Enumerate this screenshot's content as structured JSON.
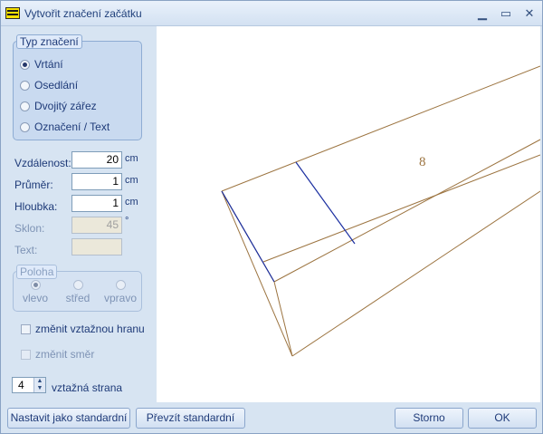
{
  "window": {
    "title": "Vytvořit značení začátku"
  },
  "type_group": {
    "legend": "Typ značení",
    "options": [
      "Vrtání",
      "Osedlání",
      "Dvojitý zářez",
      "Označení / Text"
    ],
    "selected": "Vrtání"
  },
  "fields": {
    "distance": {
      "label": "Vzdálenost:",
      "value": "20",
      "unit": "cm"
    },
    "diameter": {
      "label": "Průměr:",
      "value": "1",
      "unit": "cm"
    },
    "depth": {
      "label": "Hloubka:",
      "value": "1",
      "unit": "cm"
    },
    "slope": {
      "label": "Sklon:",
      "value": "45",
      "unit": "°"
    },
    "text": {
      "label": "Text:",
      "value": ""
    }
  },
  "position_group": {
    "legend": "Poloha",
    "options": [
      "vlevo",
      "střed",
      "vpravo"
    ],
    "selected": "vlevo"
  },
  "checks": {
    "change_reference_edge": "změnit vztažnou hranu",
    "change_direction": "změnit směr"
  },
  "reference_side": {
    "value": "4",
    "label": "vztažná strana"
  },
  "buttons": {
    "set_default": "Nastavit jako standardní",
    "load_default": "Převzít standardní",
    "cancel": "Storno",
    "ok": "OK"
  },
  "viewport": {
    "marker_text": "8"
  },
  "colors": {
    "beam_edge": "#9c7440",
    "marking_line": "#1a2ea0",
    "accent": "#1e3a78"
  }
}
